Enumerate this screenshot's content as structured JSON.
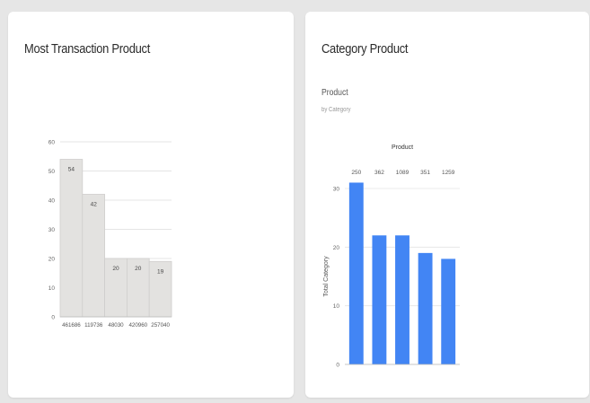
{
  "cards": {
    "left": {
      "title": "Most Transaction Product"
    },
    "right": {
      "title": "Category Product",
      "subtitle": "Product",
      "caption": "by Category"
    }
  },
  "chart_data": [
    {
      "type": "bar",
      "categories": [
        "461686",
        "119736",
        "48030",
        "420960",
        "257040"
      ],
      "values": [
        54,
        42,
        20,
        20,
        19
      ],
      "title": "",
      "xlabel": "",
      "ylabel": "",
      "ylim": [
        0,
        60
      ],
      "yticks": [
        0,
        10,
        20,
        30,
        40,
        50,
        60
      ],
      "data_labels": true,
      "grid": true,
      "bar_color": "#e3e2e0",
      "bar_edge_color": "#cfcecc"
    },
    {
      "type": "bar",
      "categories": [
        "250",
        "362",
        "1089",
        "351",
        "1259"
      ],
      "values": [
        31,
        22,
        22,
        19,
        18
      ],
      "title": "Product",
      "xlabel": "",
      "ylabel": "Total Category",
      "ylim": [
        0,
        30
      ],
      "yticks": [
        0,
        10,
        20,
        30
      ],
      "category_labels_position": "top",
      "grid": true,
      "bar_color": "#4285f4"
    }
  ]
}
